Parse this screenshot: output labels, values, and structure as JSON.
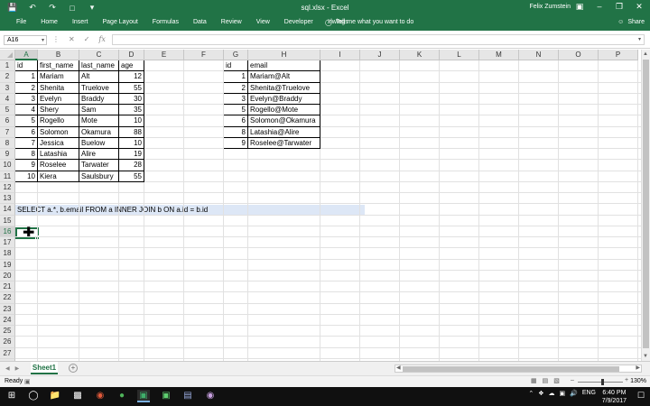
{
  "titlebar": {
    "doc_title": "sql.xlsx - Excel",
    "user": "Felix Zumstein",
    "qat_icons": [
      "save-icon",
      "undo-icon",
      "redo-icon",
      "new-file-icon",
      "customize-icon"
    ],
    "window_controls": [
      "ribbon-display-icon",
      "minimize-icon",
      "restore-icon",
      "close-icon"
    ]
  },
  "ribbon": {
    "tabs": [
      "File",
      "Home",
      "Insert",
      "Page Layout",
      "Formulas",
      "Data",
      "Review",
      "View",
      "Developer",
      "xlwings"
    ],
    "tell_me": "Tell me what you want to do",
    "share": "Share"
  },
  "formula_bar": {
    "name_box": "A16",
    "content": ""
  },
  "columns": [
    "A",
    "B",
    "C",
    "D",
    "E",
    "F",
    "G",
    "H",
    "I",
    "J",
    "K",
    "L",
    "M",
    "N",
    "O",
    "P"
  ],
  "selected_column": "A",
  "rows": [
    "1",
    "2",
    "3",
    "4",
    "5",
    "6",
    "7",
    "8",
    "9",
    "10",
    "11",
    "12",
    "13",
    "14",
    "15",
    "16",
    "17",
    "18",
    "19",
    "20",
    "21",
    "22",
    "23",
    "24",
    "25",
    "26",
    "27",
    "28"
  ],
  "selected_row": "16",
  "table_a": {
    "headers": [
      "id",
      "first_name",
      "last_name",
      "age"
    ],
    "rows": [
      [
        "1",
        "Mariam",
        "Alt",
        "12"
      ],
      [
        "2",
        "Shenita",
        "Truelove",
        "55"
      ],
      [
        "3",
        "Evelyn",
        "Braddy",
        "30"
      ],
      [
        "4",
        "Shery",
        "Sam",
        "35"
      ],
      [
        "5",
        "Rogello",
        "Mote",
        "10"
      ],
      [
        "6",
        "Solomon",
        "Okamura",
        "88"
      ],
      [
        "7",
        "Jessica",
        "Buelow",
        "10"
      ],
      [
        "8",
        "Latashia",
        "Alire",
        "19"
      ],
      [
        "9",
        "Roselee",
        "Tarwater",
        "28"
      ],
      [
        "10",
        "Kiera",
        "Saulsbury",
        "55"
      ]
    ]
  },
  "table_b": {
    "headers": [
      "id",
      "email"
    ],
    "rows": [
      [
        "1",
        "Mariam@Alt"
      ],
      [
        "2",
        "Shenita@Truelove"
      ],
      [
        "3",
        "Evelyn@Braddy"
      ],
      [
        "5",
        "Rogello@Mote"
      ],
      [
        "6",
        "Solomon@Okamura"
      ],
      [
        "8",
        "Latashia@Alire"
      ],
      [
        "9",
        "Roselee@Tarwater"
      ]
    ]
  },
  "sql_cell": "SELECT a.*, b.email FROM a INNER JOIN b ON a.id = b.id",
  "sheets": [
    "Sheet1"
  ],
  "status": {
    "ready": "Ready",
    "zoom": "130%"
  },
  "taskbar": {
    "time": "6:40 PM",
    "date": "7/9/2017",
    "lang": "ENG"
  },
  "colors": {
    "excel_green": "#217346",
    "sql_highlight": "#dde7f6"
  }
}
